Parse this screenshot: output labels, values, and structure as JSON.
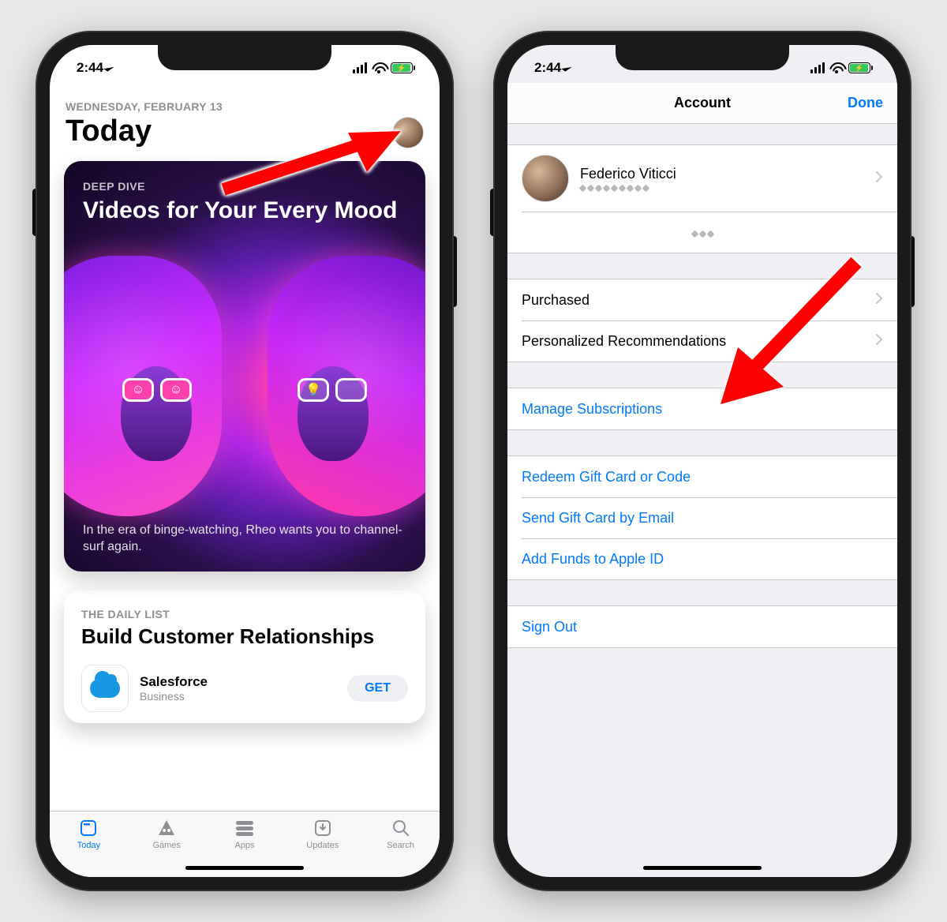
{
  "status": {
    "time": "2:44"
  },
  "left": {
    "date": "WEDNESDAY, FEBRUARY 13",
    "title": "Today",
    "hero": {
      "eyebrow": "DEEP DIVE",
      "title": "Videos for Your Every Mood",
      "blurb": "In the era of binge-watching, Rheo wants you to channel-surf again."
    },
    "list": {
      "eyebrow": "THE DAILY LIST",
      "title": "Build Customer Relationships",
      "app": {
        "name": "Salesforce",
        "category": "Business",
        "action": "GET"
      }
    },
    "tabs": {
      "today": "Today",
      "games": "Games",
      "apps": "Apps",
      "updates": "Updates",
      "search": "Search"
    }
  },
  "right": {
    "nav": {
      "title": "Account",
      "done": "Done"
    },
    "profile": {
      "name": "Federico Viticci"
    },
    "rows": {
      "purchased": "Purchased",
      "recs": "Personalized Recommendations",
      "subs": "Manage Subscriptions",
      "redeem": "Redeem Gift Card or Code",
      "sendgift": "Send Gift Card by Email",
      "addfunds": "Add Funds to Apple ID",
      "signout": "Sign Out"
    }
  }
}
